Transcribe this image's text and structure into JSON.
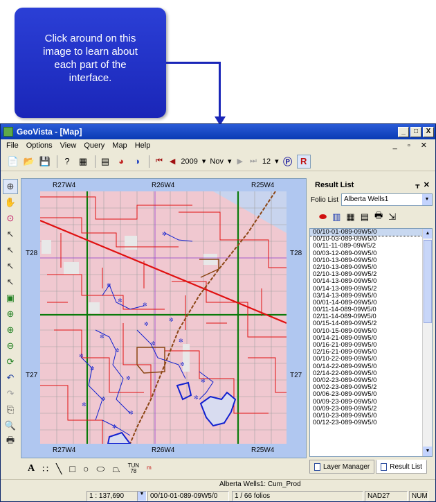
{
  "callout": {
    "text_line1": "Click around on this",
    "text_line2": "image to learn about",
    "text_line3": "each part of the",
    "text_line4": "interface."
  },
  "window": {
    "title": "GeoVista - [Map]",
    "controls": {
      "minimize": "_",
      "restore": "□",
      "close": "X"
    }
  },
  "menu": {
    "items": [
      "File",
      "Options",
      "View",
      "Query",
      "Map",
      "Help"
    ],
    "mdi_controls": "_ ▫ ✕"
  },
  "toolbar": {
    "year": "2009",
    "month": "Nov",
    "day": "12"
  },
  "map": {
    "range_labels_top": [
      "R27W4",
      "R26W4",
      "R25W4"
    ],
    "range_labels_bottom": [
      "R27W4",
      "R26W4",
      "R25W4"
    ],
    "township_labels_left": [
      "T28",
      "T27"
    ],
    "township_labels_right": [
      "T28",
      "T27"
    ],
    "colors": {
      "background": "#f0c8d0",
      "roads": "#e01010",
      "grid_major": "#0a7a0a",
      "grid_minor": "#a0a0a0",
      "wells": "#1020d0",
      "river": "#8b4513",
      "water": "#b0c7f0"
    }
  },
  "bottom_tools": {
    "text_tool": "A",
    "grid_label_top": "TUN",
    "grid_label_bottom": "78"
  },
  "result_panel": {
    "title": "Result List",
    "pin": "ᚁ",
    "close": "✕",
    "folio_label": "Folio List",
    "folio_value": "Alberta Wells1",
    "items": [
      "00/10-01-089-09W5/0",
      "00/10-03-089-09W5/0",
      "00/11-11-089-09W5/2",
      "00/03-12-089-09W5/0",
      "00/10-13-089-09W5/0",
      "02/10-13-089-09W5/0",
      "02/10-13-089-09W5/2",
      "00/14-13-089-09W5/0",
      "00/14-13-089-09W5/2",
      "03/14-13-089-09W5/0",
      "00/01-14-089-09W5/0",
      "00/11-14-089-09W5/0",
      "02/11-14-089-09W5/0",
      "00/15-14-089-09W5/2",
      "00/10-15-089-09W5/0",
      "00/14-21-089-09W5/0",
      "00/16-21-089-09W5/0",
      "02/16-21-089-09W5/0",
      "00/10-22-089-09W5/0",
      "00/14-22-089-09W5/0",
      "02/14-22-089-09W5/0",
      "00/02-23-089-09W5/0",
      "00/02-23-089-09W5/2",
      "00/06-23-089-09W5/0",
      "00/09-23-089-09W5/0",
      "00/09-23-089-09W5/2",
      "00/10-23-089-09W5/0",
      "00/12-23-089-09W5/0"
    ],
    "tabs": [
      "Layer Manager",
      "Result List"
    ]
  },
  "status": {
    "layer_info": "Alberta Wells1: Cum_Prod",
    "scale": "1 : 137,690",
    "current_well": "00/10-01-089-09W5/0",
    "folio_count": "1 / 66 folios",
    "datum": "NAD27",
    "num": "NUM"
  }
}
